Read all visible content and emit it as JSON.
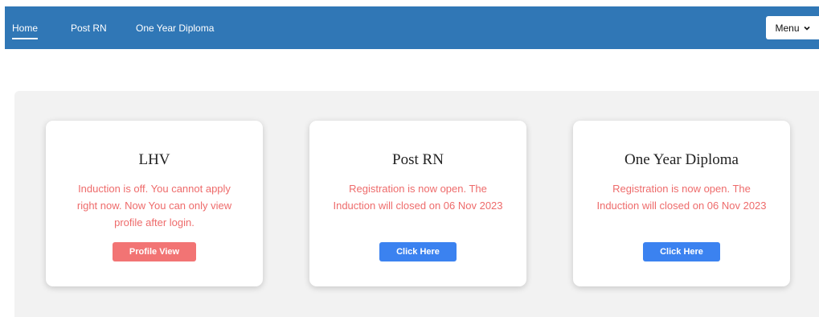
{
  "nav": {
    "links": [
      {
        "label": "Home"
      },
      {
        "label": "Post RN"
      },
      {
        "label": "One Year Diploma"
      }
    ],
    "menu_label": "Menu",
    "menu_icon": "chevron-down-icon",
    "bar_color": "#3077b6"
  },
  "cards": [
    {
      "title": "LHV",
      "text": "Induction is off. You cannot apply right now. Now You can only view profile after login.",
      "button": "Profile View",
      "button_color": "#f27474"
    },
    {
      "title": "Post RN",
      "text": "Registration is now open. The Induction will closed on 06 Nov 2023",
      "button": "Click Here",
      "button_color": "#3b82f0"
    },
    {
      "title": "One Year Diploma",
      "text": "Registration is now open. The Induction will closed on 06 Nov 2023",
      "button": "Click Here",
      "button_color": "#3b82f0"
    }
  ],
  "colors": {
    "alert_text": "#ee6b6b",
    "panel_bg": "#f2f2f2"
  }
}
